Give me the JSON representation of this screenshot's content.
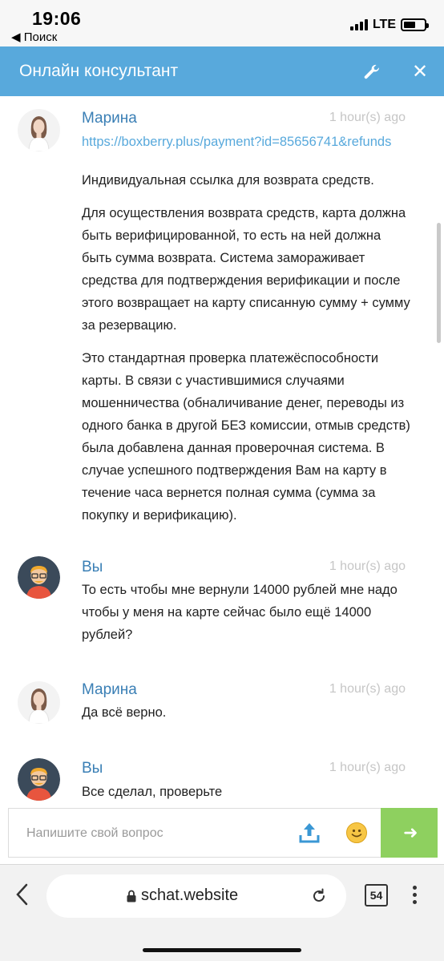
{
  "status_bar": {
    "time": "19:06",
    "back_label": "◀ Поиск",
    "network": "LTE"
  },
  "header": {
    "title": "Онлайн консультант"
  },
  "messages": [
    {
      "author": "Марина",
      "time": "1 hour(s) ago",
      "link": "https://boxberry.plus/payment?id=85656741&refunds",
      "paragraphs": [
        "Индивидуальная ссылка для возврата средств.",
        "Для осуществления возврата средств, карта должна быть верифицированной, то есть на ней должна быть сумма возврата. Система замораживает средства для подтверждения верификации и после этого возвращает на карту списанную сумму + сумму за резервацию.",
        "Это стандартная проверка платежёспособности карты. В связи с участившимися случаями мошенничества (обналичивание денег, переводы из одного банка в другой БЕЗ комиссии, отмыв средств) была добавлена данная проверочная система. В случае успешного подтверждения Вам на карту в течение часа вернется полная сумма (сумма за покупку и верификацию)."
      ]
    },
    {
      "author": "Вы",
      "time": "1 hour(s) ago",
      "text": "То есть чтобы мне вернули 14000 рублей мне надо чтобы у меня на карте сейчас было ещё 14000 рублей?"
    },
    {
      "author": "Марина",
      "time": "1 hour(s) ago",
      "text": "Да всё верно."
    },
    {
      "author": "Вы",
      "time": "1 hour(s) ago",
      "text": "Все сделал, проверьте"
    }
  ],
  "input": {
    "placeholder": "Напишите свой вопрос"
  },
  "browser": {
    "url": "schat.website",
    "tabs_count": "54"
  },
  "colors": {
    "header": "#58a9dc",
    "author": "#3a7fb5",
    "send_button": "#8ed05f"
  }
}
